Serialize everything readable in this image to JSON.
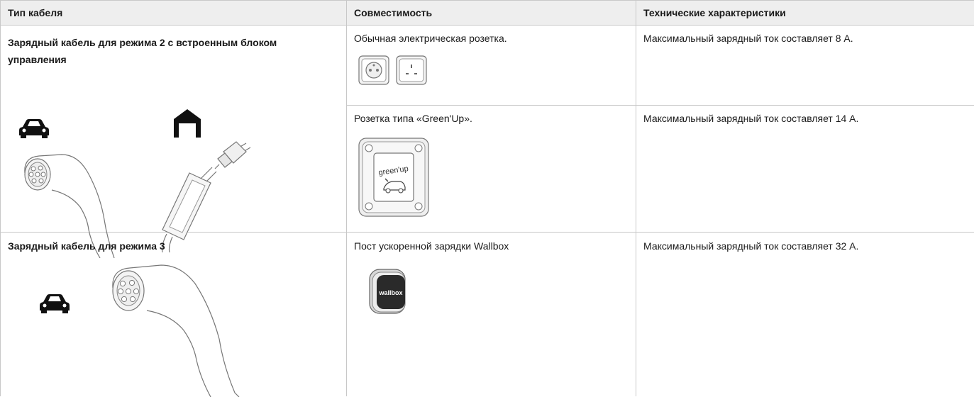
{
  "header": {
    "col1": "Тип кабеля",
    "col2": "Совместимость",
    "col3": "Технические характеристики"
  },
  "rows": [
    {
      "cable_type": "Зарядный кабель для режима 2 с встроенным блоком управления",
      "compat": [
        {
          "text": "Обычная электрическая розетка.",
          "spec": "Максимальный зарядный ток составляет 8 A."
        },
        {
          "text": "Розетка типа «Green'Up».",
          "spec": "Максимальный зарядный ток составляет 14 A.",
          "socket_label": "green'up"
        }
      ]
    },
    {
      "cable_type": "Зарядный кабель для режима 3",
      "compat": [
        {
          "text": "Пост ускоренной зарядки Wallbox",
          "spec": "Максимальный зарядный ток составляет 32 A.",
          "device_label": "wallbox"
        }
      ]
    }
  ],
  "icons": [
    "car-icon",
    "garage-icon",
    "type2-connector-icon",
    "plug-control-box-icon",
    "french-socket-icon",
    "uk-socket-icon",
    "greenup-socket-icon",
    "wallbox-icon"
  ]
}
